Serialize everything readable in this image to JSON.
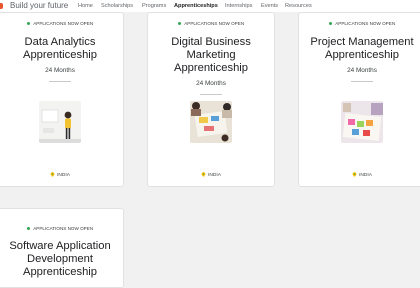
{
  "header": {
    "brand": "Build your future",
    "nav": [
      {
        "label": "Home"
      },
      {
        "label": "Scholarships"
      },
      {
        "label": "Programs"
      },
      {
        "label": "Apprenticeships",
        "active": true
      },
      {
        "label": "Internships"
      },
      {
        "label": "Events"
      },
      {
        "label": "Resources"
      }
    ]
  },
  "cards": [
    {
      "status": "APPLICATIONS NOW OPEN",
      "title_lines": [
        "Data Analytics",
        "Apprenticeship"
      ],
      "duration": "24 Months",
      "location": "INDIA"
    },
    {
      "status": "APPLICATIONS NOW OPEN",
      "title_lines": [
        "Digital Business",
        "Marketing",
        "Apprenticeship"
      ],
      "duration": "24 Months",
      "location": "INDIA"
    },
    {
      "status": "APPLICATIONS NOW OPEN",
      "title_lines": [
        "Project Management",
        "Apprenticeship"
      ],
      "duration": "24 Months",
      "location": "INDIA"
    },
    {
      "status": "APPLICATIONS NOW OPEN",
      "title_lines": [
        "Software Application",
        "Development",
        "Apprenticeship"
      ]
    }
  ],
  "colors": {
    "status_dot": "#34a853",
    "brand_accent": "#e8542e"
  }
}
